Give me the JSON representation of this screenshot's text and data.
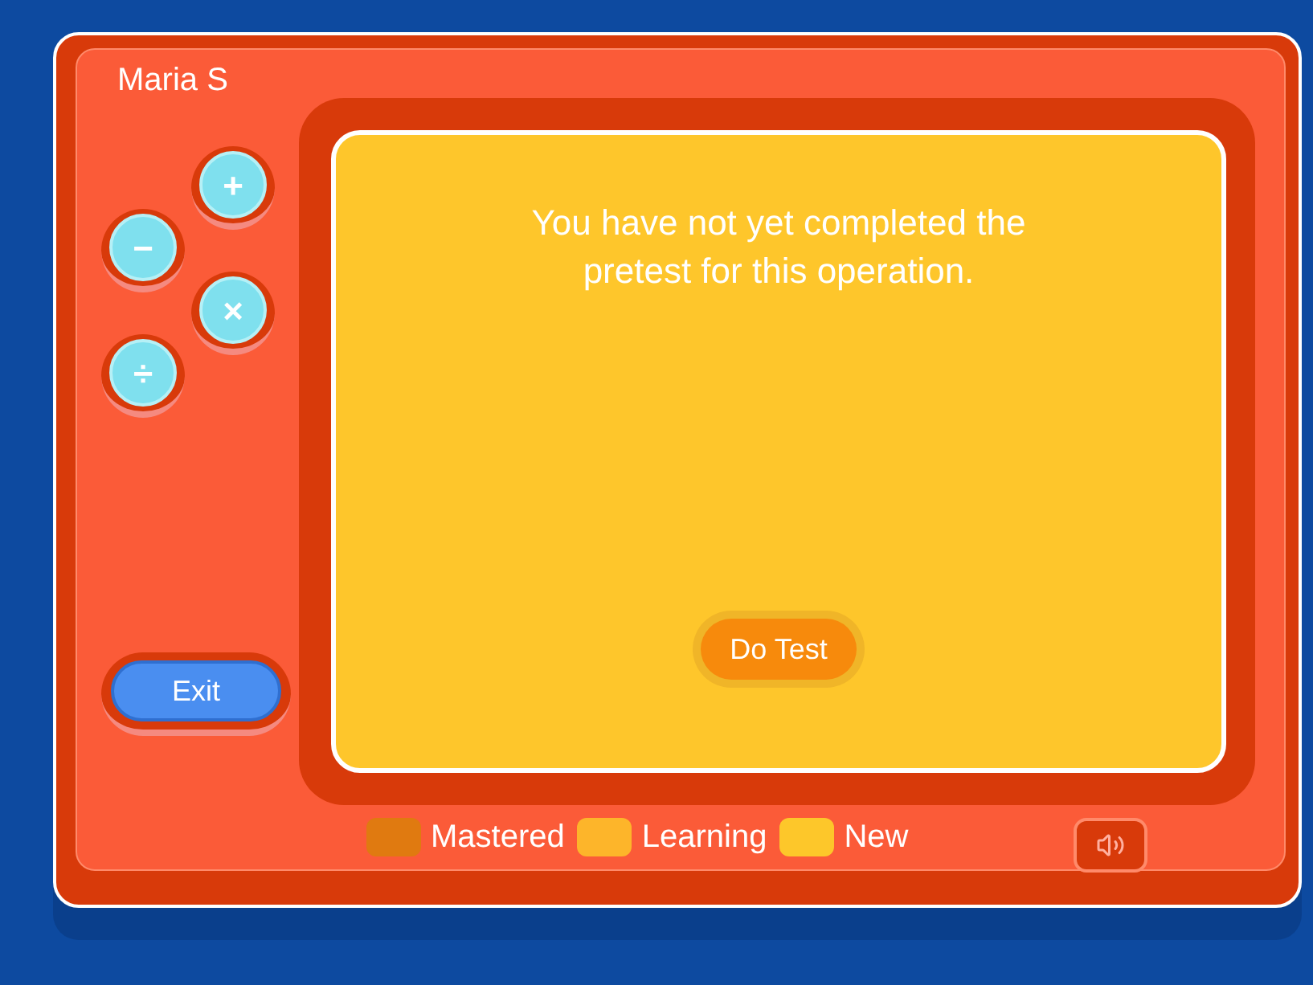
{
  "user_name": "Maria S",
  "operations": [
    {
      "symbol": "+"
    },
    {
      "symbol": "−"
    },
    {
      "symbol": "×"
    },
    {
      "symbol": "÷"
    }
  ],
  "exit_button": "Exit",
  "message": "You have not yet completed the pretest for this operation.",
  "test_button": "Do Test",
  "legend": [
    {
      "label": "Mastered",
      "color": "#e07a10"
    },
    {
      "label": "Learning",
      "color": "#fdb52a"
    },
    {
      "label": "New",
      "color": "#fdc72a"
    }
  ]
}
